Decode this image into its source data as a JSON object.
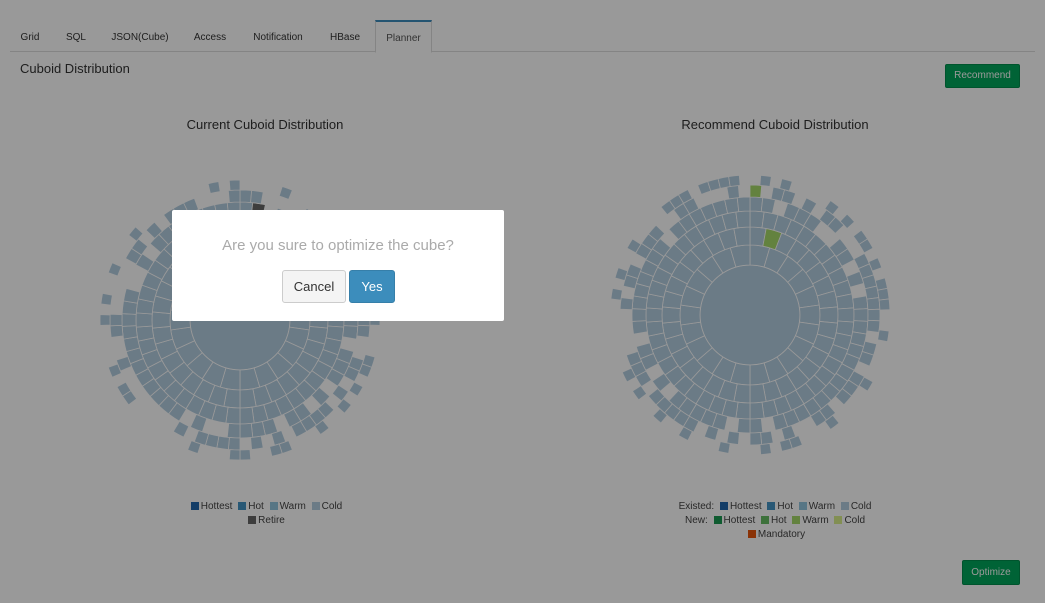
{
  "tabs": [
    {
      "label": "Grid"
    },
    {
      "label": "SQL"
    },
    {
      "label": "JSON(Cube)"
    },
    {
      "label": "Access"
    },
    {
      "label": "Notification"
    },
    {
      "label": "HBase"
    },
    {
      "label": "Planner",
      "active": true
    }
  ],
  "section_title": "Cuboid Distribution",
  "recommend_button": "Recommend",
  "optimize_button": "Optimize",
  "current_chart": {
    "title": "Current Cuboid Distribution",
    "legend": {
      "hottest": "Hottest",
      "hot": "Hot",
      "warm": "Warm",
      "cold": "Cold",
      "retire": "Retire"
    }
  },
  "recommend_chart": {
    "title": "Recommend Cuboid Distribution",
    "legend": {
      "existed_label": "Existed:",
      "new_label": "New:",
      "hottest": "Hottest",
      "hot": "Hot",
      "warm": "Warm",
      "cold": "Cold",
      "mandatory": "Mandatory"
    }
  },
  "colors": {
    "hottest": "#2166ac",
    "hot": "#4393c3",
    "warm": "#92c5de",
    "cold": "#b3cde0",
    "retire": "#666666",
    "new_hottest": "#1a9850",
    "new_hot": "#66bd63",
    "new_warm": "#a6d96a",
    "new_cold": "#d9ef8b",
    "mandatory": "#e6550d"
  },
  "dialog": {
    "message": "Are you sure to optimize the cube?",
    "cancel": "Cancel",
    "yes": "Yes"
  }
}
